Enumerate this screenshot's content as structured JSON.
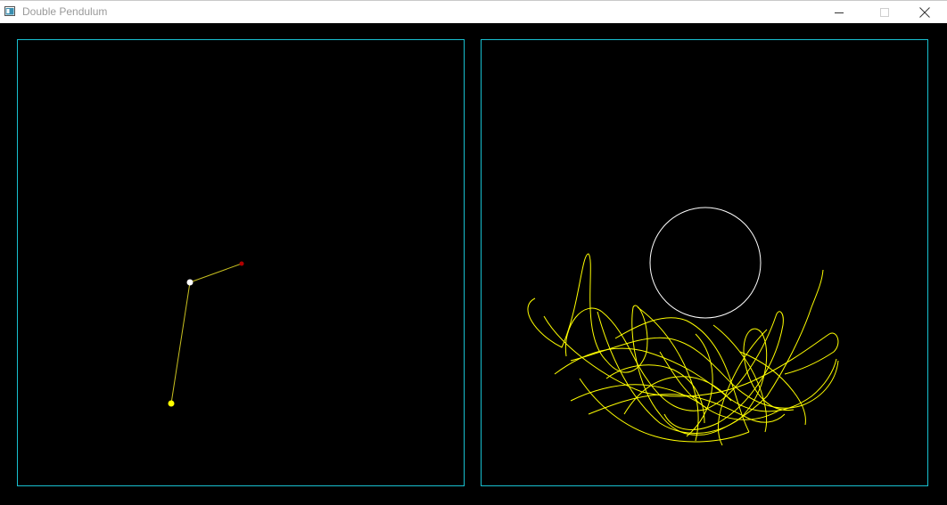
{
  "window": {
    "title": "Double Pendulum",
    "controls": {
      "minimize_icon": "minimize-icon",
      "maximize_icon": "maximize-icon",
      "close_icon": "close-icon"
    }
  },
  "colors": {
    "background": "#000000",
    "panel_border": "#18c0d0",
    "rod": "#c8c020",
    "pivot": "#ffffff",
    "bob1": "#ffff00",
    "bob2": "#b00000",
    "trace": "#ffff00",
    "ring": "#ffffff"
  },
  "pendulum": {
    "pivot_icon": "white-dot",
    "bob1_icon": "yellow-dot",
    "bob2_icon": "red-dot"
  }
}
